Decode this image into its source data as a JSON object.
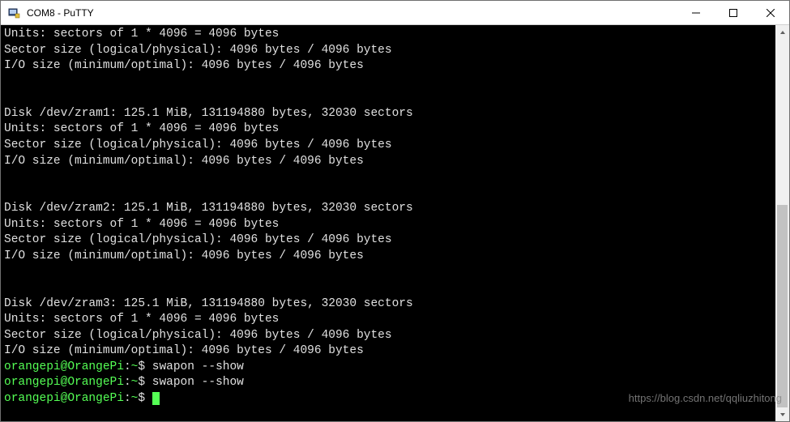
{
  "window": {
    "title": "COM8 - PuTTY"
  },
  "terminal": {
    "block0": {
      "l1": "Units: sectors of 1 * 4096 = 4096 bytes",
      "l2": "Sector size (logical/physical): 4096 bytes / 4096 bytes",
      "l3": "I/O size (minimum/optimal): 4096 bytes / 4096 bytes"
    },
    "block1": {
      "header": "Disk /dev/zram1: 125.1 MiB, 131194880 bytes, 32030 sectors",
      "l1": "Units: sectors of 1 * 4096 = 4096 bytes",
      "l2": "Sector size (logical/physical): 4096 bytes / 4096 bytes",
      "l3": "I/O size (minimum/optimal): 4096 bytes / 4096 bytes"
    },
    "block2": {
      "header": "Disk /dev/zram2: 125.1 MiB, 131194880 bytes, 32030 sectors",
      "l1": "Units: sectors of 1 * 4096 = 4096 bytes",
      "l2": "Sector size (logical/physical): 4096 bytes / 4096 bytes",
      "l3": "I/O size (minimum/optimal): 4096 bytes / 4096 bytes"
    },
    "block3": {
      "header": "Disk /dev/zram3: 125.1 MiB, 131194880 bytes, 32030 sectors",
      "l1": "Units: sectors of 1 * 4096 = 4096 bytes",
      "l2": "Sector size (logical/physical): 4096 bytes / 4096 bytes",
      "l3": "I/O size (minimum/optimal): 4096 bytes / 4096 bytes"
    },
    "prompt1": {
      "user": "orangepi@OrangePi",
      "path": "~",
      "cmd": "swapon --show"
    },
    "prompt2": {
      "user": "orangepi@OrangePi",
      "path": "~",
      "cmd": "swapon --show"
    },
    "prompt3": {
      "user": "orangepi@OrangePi",
      "path": "~",
      "cmd": ""
    }
  },
  "watermark": "https://blog.csdn.net/qqliuzhitong"
}
